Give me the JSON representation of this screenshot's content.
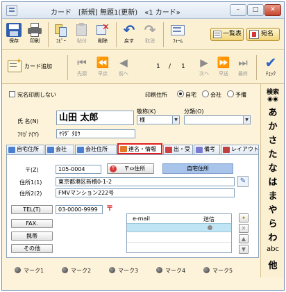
{
  "window": {
    "title": "カード　[新規]  無題1(更新)　«1 カード»",
    "minimize": "–",
    "maximize": "□",
    "close": "✕"
  },
  "toolbar": {
    "save": "保存",
    "print": "印刷",
    "copy": "ｺﾋﾟｰ",
    "paste": "貼付",
    "delete": "削除",
    "undo": "戻す",
    "redo": "取消",
    "form": "ﾌｫｰﾑ",
    "list": "一覧表",
    "addressee": "宛名"
  },
  "nav": {
    "add_card": "カード追加",
    "first": "先頭",
    "fast_back": "早戻",
    "prev": "前へ",
    "position": "1",
    "separator": "/",
    "total": "1",
    "next": "次へ",
    "fast_forward": "早送",
    "last": "最終",
    "check": "ﾁｪｯｸ"
  },
  "sidebar": {
    "search": "検索",
    "kana": [
      "あ",
      "か",
      "さ",
      "た",
      "な",
      "は",
      "ま",
      "や",
      "ら",
      "わ",
      "abc",
      "他"
    ]
  },
  "form": {
    "no_print_label": "宛名印刷しない",
    "print_address_label": "印刷住所",
    "print_address_options": [
      "自宅",
      "会社",
      "予備"
    ],
    "print_address_selected": "自宅",
    "name_label": "氏 名(N)",
    "name_value": "山田 太郎",
    "furigana_label": "ﾌﾘｶﾞﾅ(Y)",
    "furigana_value": "ﾔﾏﾀﾞ ﾀﾛｳ",
    "honorific_label": "敬称(K)",
    "honorific_value": "様",
    "category_label": "分類(O)",
    "category_value": ""
  },
  "tabs": [
    {
      "label": "自宅住所",
      "color": "#4a7fd0"
    },
    {
      "label": "会社",
      "color": "#4a7fd0"
    },
    {
      "label": "会社住所",
      "color": "#4a7fd0"
    },
    {
      "label": "連名・情報",
      "color": "#e07a2a"
    },
    {
      "label": "出・受",
      "color": "#d04040"
    },
    {
      "label": "備考",
      "color": "#7a7ad0"
    },
    {
      "label": "レイアウト",
      "color": "#c04040"
    }
  ],
  "address": {
    "zip_label": "〒(Z)",
    "zip_value": "105-0004",
    "zip_convert_button": "〒⇔住所",
    "home_address_button": "自宅住所",
    "address1_label": "住所1(1)",
    "address1_value": "東京都港区新橋0-1-2",
    "address2_label": "住所2(2)",
    "address2_value": "FMVマンション222号"
  },
  "contact": {
    "tel_label": "TEL(T)",
    "tel_value": "03-0000-9999",
    "fax_label": "FAX.",
    "mobile_label": "携帯",
    "other_label": "その他",
    "email_header": "e-mail",
    "send_header": "送信"
  },
  "marks": [
    "マーク1",
    "マーク2",
    "マーク3",
    "マーク4",
    "マーク5"
  ]
}
